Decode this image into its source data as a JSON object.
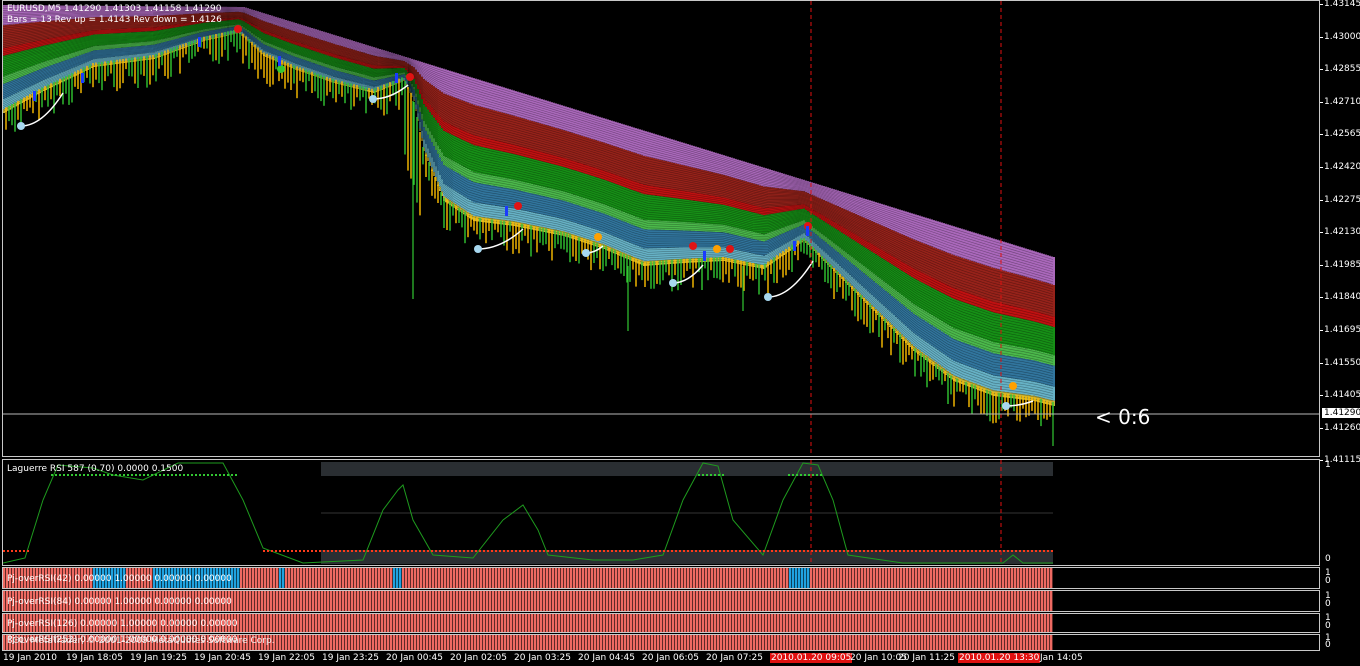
{
  "chart": {
    "header_line1": "EURUSD,M5  1.41290 1.41303 1.41158 1.41290",
    "header_line2": "Bars = 13 Rev up =  1.4143 Rev down = 1.4126",
    "price_ticks": [
      "1.43145",
      "1.43000",
      "1.42855",
      "1.42710",
      "1.42565",
      "1.42420",
      "1.42275",
      "1.42130",
      "1.41985",
      "1.41840",
      "1.41695",
      "1.41550",
      "1.41405",
      "1.41260",
      "1.41115"
    ],
    "current_price": "1.41290",
    "countdown": "< 0:6"
  },
  "rsi_panel": {
    "label": "Laguerre RSI 587 (0.70) 0.0000 0.1500",
    "scale_top": "1",
    "scale_bottom": "0"
  },
  "over_panels": [
    {
      "label": "Pj-overRSI(42) 0.00000 1.00000 0.00000 0.00000",
      "scale_top": "1",
      "scale_bottom": "0"
    },
    {
      "label": "Pj-overRSI(84) 0.00000 1.00000 0.00000 0.00000",
      "scale_top": "1",
      "scale_bottom": "0"
    },
    {
      "label": "Pj-overRSI(126) 0.00000 1.00000 0.00000 0.00000",
      "scale_top": "1",
      "scale_bottom": "0"
    },
    {
      "label": "Pj-overRSI(252) 0.00000 1.00000 0.00000 0.00000",
      "scale_top": "1",
      "scale_bottom": "0"
    }
  ],
  "copyright": "SOL. MetaTrader, © 2001-2009 MetaQuotes Software Corp.",
  "time_labels": [
    {
      "text": "19 Jan 2010",
      "hl": false
    },
    {
      "text": "19 Jan 18:05",
      "hl": false
    },
    {
      "text": "19 Jan 19:25",
      "hl": false
    },
    {
      "text": "19 Jan 20:45",
      "hl": false
    },
    {
      "text": "19 Jan 22:05",
      "hl": false
    },
    {
      "text": "19 Jan 23:25",
      "hl": false
    },
    {
      "text": "20 Jan 00:45",
      "hl": false
    },
    {
      "text": "20 Jan 02:05",
      "hl": false
    },
    {
      "text": "20 Jan 03:25",
      "hl": false
    },
    {
      "text": "20 Jan 04:45",
      "hl": false
    },
    {
      "text": "20 Jan 06:05",
      "hl": false
    },
    {
      "text": "20 Jan 07:25",
      "hl": false
    },
    {
      "text": "2010.01.20 09:05",
      "hl": true
    },
    {
      "text": "20 Jan 10:05",
      "hl": false
    },
    {
      "text": "20 Jan 11:25",
      "hl": false
    },
    {
      "text": "2010.01.20 13:30",
      "hl": true
    },
    {
      "text": "Jan 14:05",
      "hl": false
    }
  ],
  "colors": {
    "background": "#000000",
    "candle_up": "#ffc000",
    "candle_down": "#32c832",
    "rsi_line": "#1e9a1e",
    "over_red": "#ee6a62",
    "over_blue": "#1fa2e0",
    "timeline_highlight": "#e01010"
  }
}
